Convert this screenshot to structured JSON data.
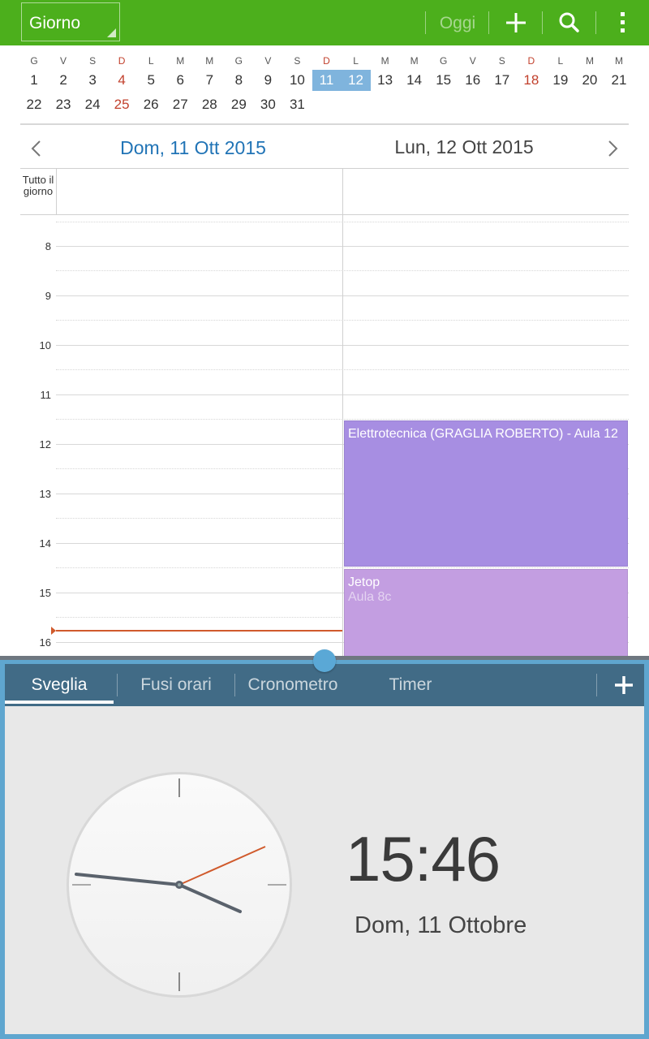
{
  "calendar": {
    "topbar": {
      "view_select": "Giorno",
      "today": "Oggi",
      "add_icon": "plus-icon",
      "search_icon": "search-icon",
      "menu_icon": "overflow-menu-icon",
      "color": "#4caf1c"
    },
    "mini": {
      "weekdays": [
        "G",
        "V",
        "S",
        "D",
        "L",
        "M",
        "M",
        "G",
        "V",
        "S",
        "D",
        "L",
        "M",
        "M",
        "G",
        "V",
        "S",
        "D",
        "L",
        "M",
        "M"
      ],
      "row1": [
        "1",
        "2",
        "3",
        "4",
        "5",
        "6",
        "7",
        "8",
        "9",
        "10",
        "11",
        "12",
        "13",
        "14",
        "15",
        "16",
        "17",
        "18",
        "19",
        "20",
        "21"
      ],
      "row2": [
        "22",
        "23",
        "24",
        "25",
        "26",
        "27",
        "28",
        "29",
        "30",
        "31"
      ]
    },
    "day_left": "Dom, 11 Ott 2015",
    "day_right": "Lun, 12 Ott 2015",
    "all_day": "Tutto il giorno",
    "hours": [
      "8",
      "9",
      "10",
      "11",
      "12",
      "13",
      "14",
      "15",
      "16"
    ],
    "events": [
      {
        "title": "Elettrotecnica (GRAGLIA ROBERTO)  - Aula 12",
        "subtitle": "",
        "color": "#a78ee2"
      },
      {
        "title": "Jetop",
        "subtitle": "Aula 8c",
        "color": "#c39ee1"
      }
    ]
  },
  "clock": {
    "tabs": [
      "Sveglia",
      "Fusi orari",
      "Cronometro",
      "Timer"
    ],
    "active_tab": "Sveglia",
    "add_icon": "plus-icon",
    "time": "15:46",
    "date": "Dom, 11 Ottobre",
    "accent": "#416b86"
  }
}
